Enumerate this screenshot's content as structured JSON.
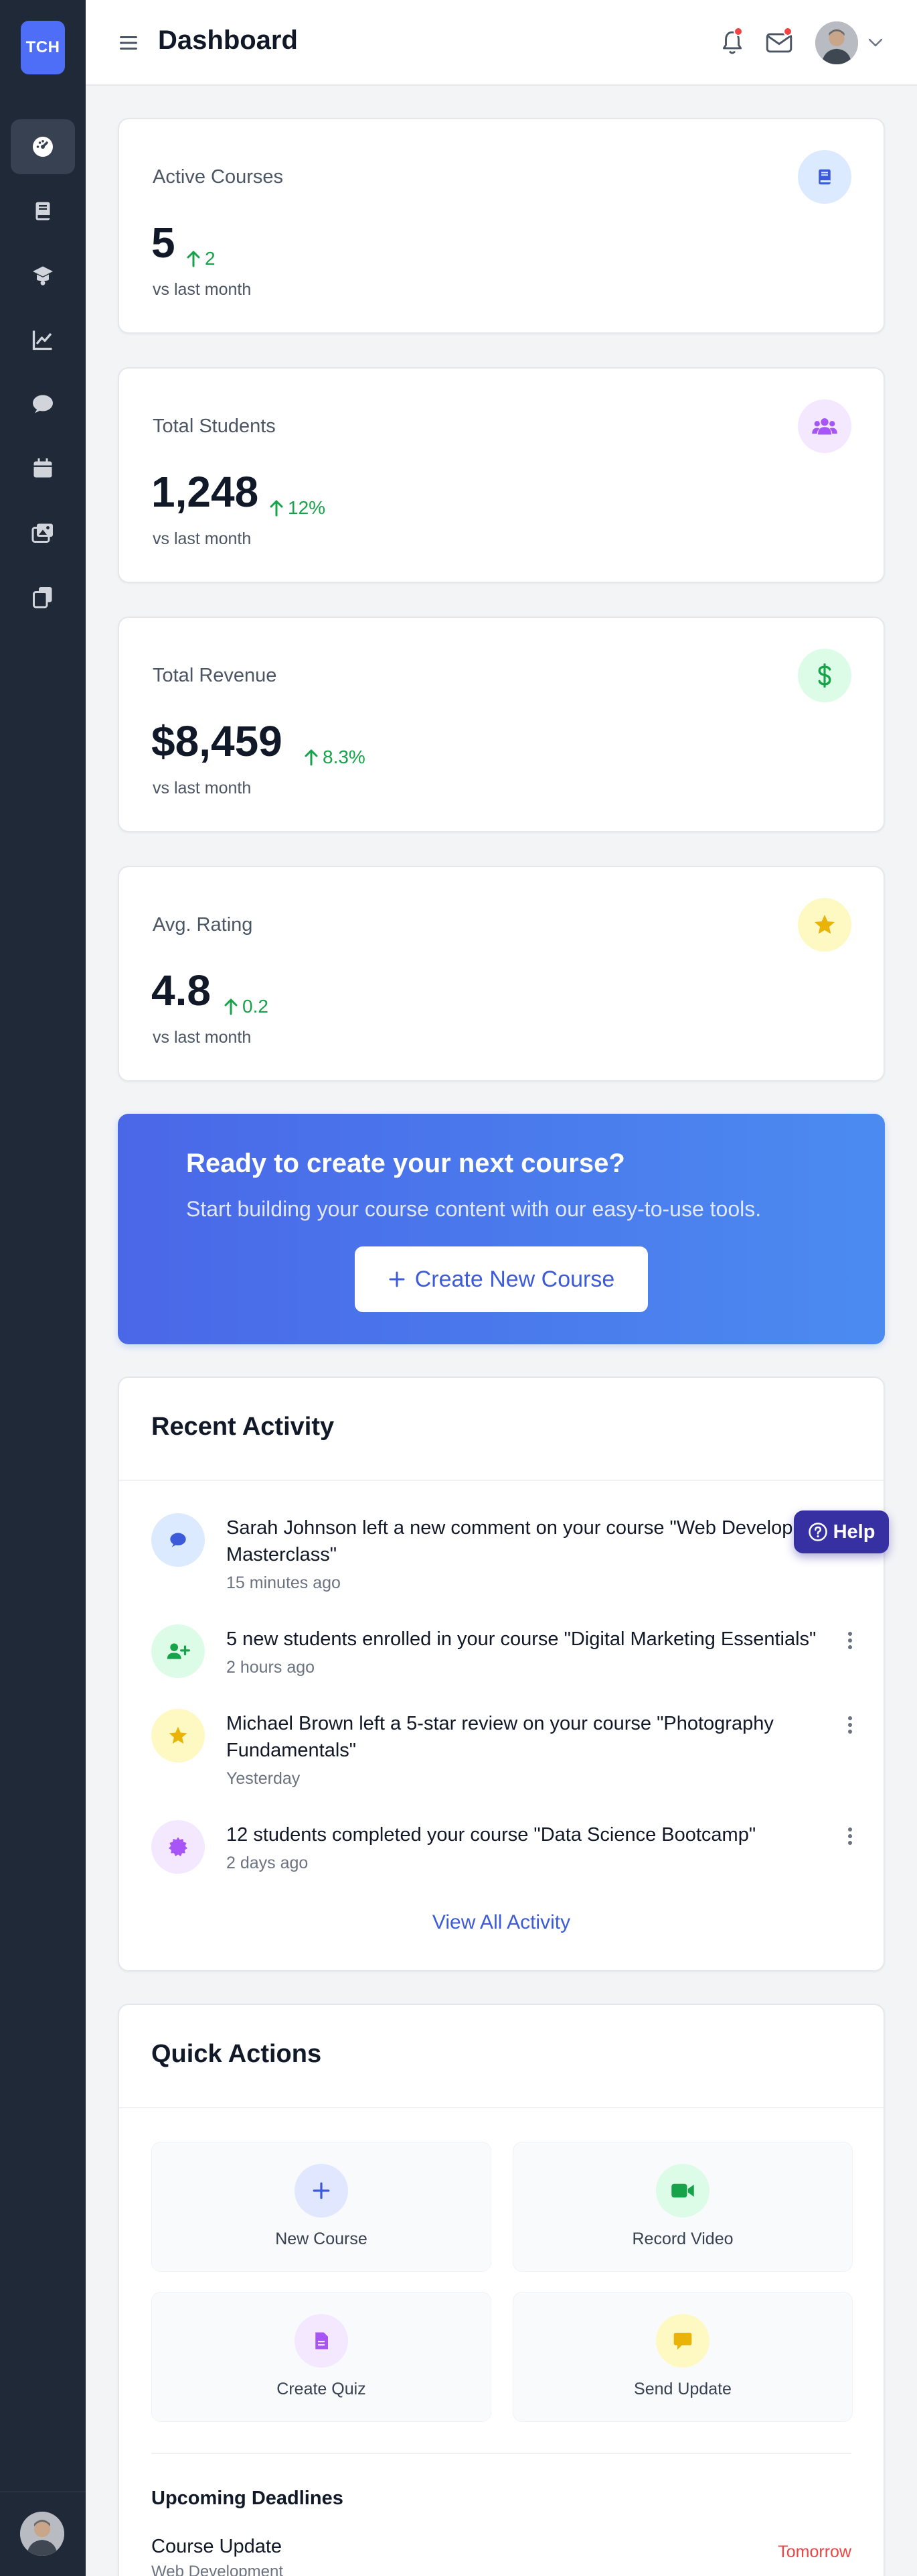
{
  "app": {
    "logo_text": "TCH"
  },
  "header": {
    "title": "Dashboard"
  },
  "sidebar": {
    "items": [
      {
        "icon": "dashboard-gauge-icon",
        "active": true
      },
      {
        "icon": "book-icon"
      },
      {
        "icon": "graduation-cap-icon"
      },
      {
        "icon": "chart-line-icon"
      },
      {
        "icon": "comment-icon"
      },
      {
        "icon": "calendar-icon"
      },
      {
        "icon": "images-icon"
      },
      {
        "icon": "copy-icon"
      }
    ]
  },
  "stats": [
    {
      "label": "Active Courses",
      "value": "5",
      "change": "2",
      "sub": "vs last month",
      "icon": "book-icon",
      "icon_bg": "#dbeafe",
      "icon_color": "#3b5bdb"
    },
    {
      "label": "Total Students",
      "value": "1,248",
      "change": "12%",
      "sub": "vs last month",
      "icon": "users-icon",
      "icon_bg": "#f3e8ff",
      "icon_color": "#a855f7"
    },
    {
      "label": "Total Revenue",
      "value": "$8,459",
      "change": "8.3%",
      "sub": "vs last month",
      "icon": "dollar-icon",
      "icon_bg": "#dcfce7",
      "icon_color": "#16a34a"
    },
    {
      "label": "Avg. Rating",
      "value": "4.8",
      "change": "0.2",
      "sub": "vs last month",
      "icon": "star-icon",
      "icon_bg": "#fef9c3",
      "icon_color": "#eab308"
    }
  ],
  "cta": {
    "title": "Ready to create your next course?",
    "subtitle": "Start building your course content with our easy-to-use tools.",
    "button": "Create New Course"
  },
  "activity": {
    "title": "Recent Activity",
    "items": [
      {
        "text": "Sarah Johnson left a new comment on your course \"Web Development Masterclass\"",
        "time": "15 minutes ago",
        "icon": "comment-icon"
      },
      {
        "text": "5 new students enrolled in your course \"Digital Marketing Essentials\"",
        "time": "2 hours ago",
        "icon": "user-plus-icon"
      },
      {
        "text": "Michael Brown left a 5-star review on your course \"Photography Fundamentals\"",
        "time": "Yesterday",
        "icon": "star-icon"
      },
      {
        "text": "12 students completed your course \"Data Science Bootcamp\"",
        "time": "2 days ago",
        "icon": "certificate-icon"
      }
    ],
    "view_all": "View All Activity"
  },
  "help": {
    "label": "Help"
  },
  "quick_actions": {
    "title": "Quick Actions",
    "items": [
      {
        "label": "New Course",
        "icon": "plus-icon"
      },
      {
        "label": "Record Video",
        "icon": "video-icon"
      },
      {
        "label": "Create Quiz",
        "icon": "file-icon"
      },
      {
        "label": "Send Update",
        "icon": "message-icon"
      }
    ]
  },
  "deadlines": {
    "title": "Upcoming Deadlines",
    "items": [
      {
        "name": "Course Update",
        "course": "Web Development",
        "due": "Tomorrow"
      }
    ]
  },
  "colors": {
    "primary": "#3b5bdb",
    "sidebar": "#1f2937",
    "positive": "#16a34a",
    "danger": "#ef4444"
  }
}
